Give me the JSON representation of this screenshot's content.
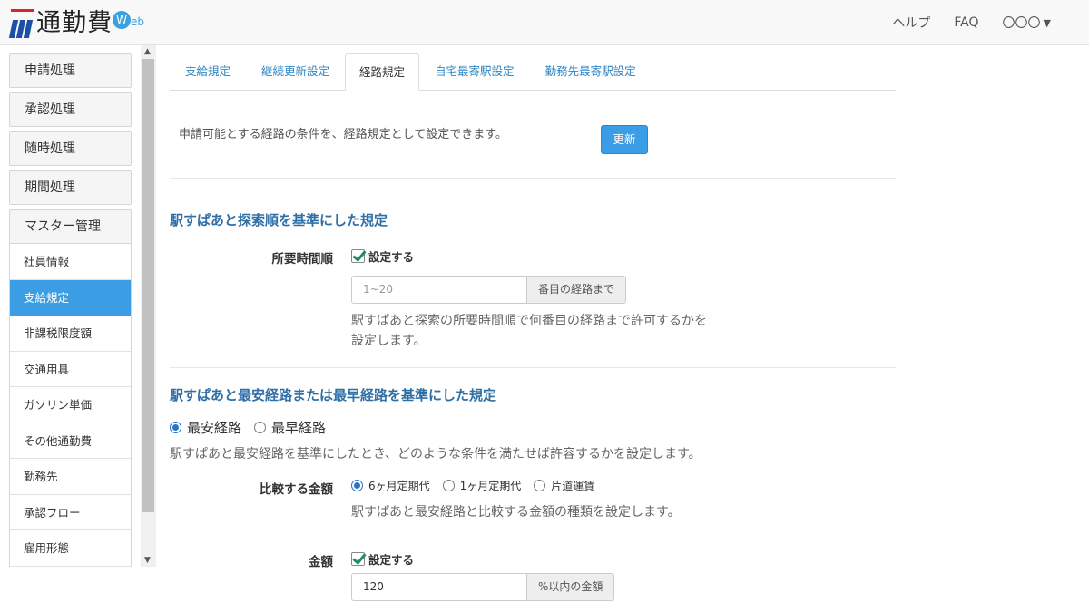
{
  "app": {
    "logo_title": "通勤費",
    "logo_web_badge": "W",
    "logo_web_tail": "eb",
    "brand_colors": {
      "blue": "#1d4fa3",
      "red": "#d6252d",
      "accent": "#3b9ee4"
    }
  },
  "header_nav": {
    "help": "ヘルプ",
    "faq": "FAQ",
    "user": "〇〇〇"
  },
  "sidebar": {
    "groups": [
      {
        "label": "申請処理"
      },
      {
        "label": "承認処理"
      },
      {
        "label": "随時処理"
      },
      {
        "label": "期間処理"
      },
      {
        "label": "マスター管理"
      }
    ],
    "sub_items": [
      {
        "label": "社員情報"
      },
      {
        "label": "支給規定",
        "active": true
      },
      {
        "label": "非課税限度額"
      },
      {
        "label": "交通用具"
      },
      {
        "label": "ガソリン単価"
      },
      {
        "label": "その他通勤費"
      },
      {
        "label": "勤務先"
      },
      {
        "label": "承認フロー"
      },
      {
        "label": "雇用形態"
      }
    ]
  },
  "tabs": [
    {
      "label": "支給規定"
    },
    {
      "label": "継続更新設定"
    },
    {
      "label": "経路規定",
      "active": true
    },
    {
      "label": "自宅最寄駅設定"
    },
    {
      "label": "勤務先最寄駅設定"
    }
  ],
  "intro": {
    "text": "申請可能とする経路の条件を、経路規定として設定できます。",
    "update_button": "更新"
  },
  "section1": {
    "title": "駅すぱあと探索順を基準にした規定",
    "field_label": "所要時間順",
    "checkbox_label": "設定する",
    "checked": true,
    "input_placeholder": "1~20",
    "input_value": "",
    "addon": "番目の経路まで",
    "help": "駅すぱあと探索の所要時間順で何番目の経路まで許可するかを設定します。"
  },
  "section2": {
    "title": "駅すぱあと最安経路または最早経路を基準にした規定",
    "route_options": [
      {
        "label": "最安経路",
        "selected": true
      },
      {
        "label": "最早経路",
        "selected": false
      }
    ],
    "description": "駅すぱあと最安経路を基準にしたとき、どのような条件を満たせば許容するかを設定します。",
    "compare_label": "比較する金額",
    "compare_options": [
      {
        "label": "6ヶ月定期代",
        "selected": true
      },
      {
        "label": "1ヶ月定期代",
        "selected": false
      },
      {
        "label": "片道運賃",
        "selected": false
      }
    ],
    "compare_help": "駅すぱあと最安経路と比較する金額の種類を設定します。",
    "amount_label": "金額",
    "amount_checkbox_label": "設定する",
    "amount_checked": true,
    "amount_value": "120",
    "amount_addon": "%以内の金額"
  }
}
